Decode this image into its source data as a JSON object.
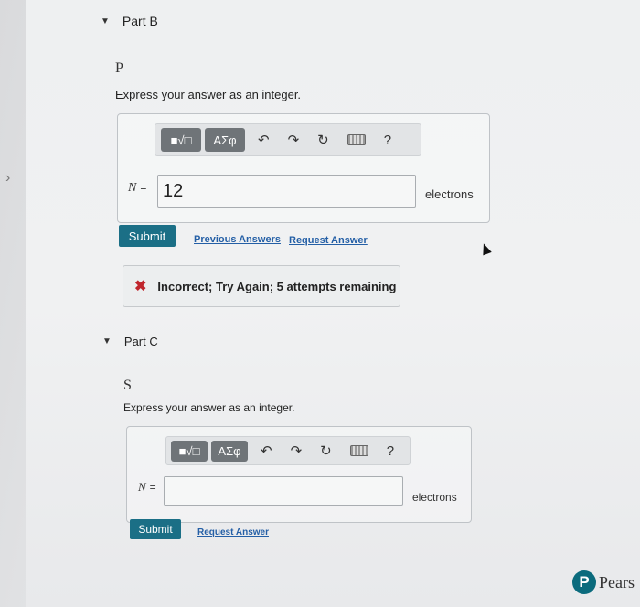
{
  "partB": {
    "header": "Part B",
    "variable": "P",
    "instruction": "Express your answer as an integer.",
    "toolbar": {
      "templates": "■√□",
      "symbols": "ΑΣφ",
      "undo": "↶",
      "redo": "↷",
      "reset": "↻",
      "help": "?"
    },
    "label": "N",
    "equals": "=",
    "value": "12",
    "unit": "electrons",
    "submit": "Submit",
    "previous_answers": "Previous Answers",
    "request_answer": "Request Answer",
    "feedback": "Incorrect; Try Again; 5 attempts remaining",
    "feedback_icon": "✖"
  },
  "partC": {
    "header": "Part C",
    "variable": "S",
    "instruction": "Express your answer as an integer.",
    "toolbar": {
      "templates": "■√□",
      "symbols": "ΑΣφ",
      "undo": "↶",
      "redo": "↷",
      "reset": "↻",
      "help": "?"
    },
    "label": "N",
    "equals": "=",
    "value": "",
    "unit": "electrons",
    "submit": "Submit",
    "request_answer": "Request Answer"
  },
  "logo": {
    "mark": "P",
    "text": "Pears"
  },
  "colors": {
    "submit": "#1b6f86",
    "link": "#245fa6",
    "error": "#c0262d"
  },
  "icons": {
    "collapse": "caret-down-icon",
    "nav": "chevron-right-icon",
    "keyboard": "keyboard-icon"
  }
}
